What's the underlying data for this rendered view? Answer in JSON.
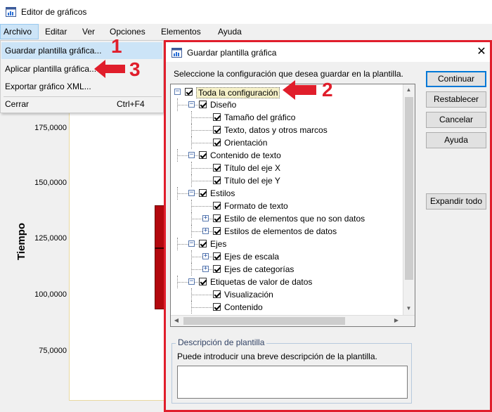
{
  "window": {
    "title": "Editor de gráficos"
  },
  "menubar": {
    "items": [
      "Archivo",
      "Editar",
      "Ver",
      "Opciones",
      "Elementos",
      "Ayuda"
    ]
  },
  "file_menu": {
    "items": [
      {
        "label": "Guardar plantilla gráfica...",
        "shortcut": ""
      },
      {
        "label": "Aplicar plantilla gráfica...",
        "shortcut": ""
      },
      {
        "label": "Exportar gráfico XML...",
        "shortcut": ""
      },
      {
        "label": "Cerrar",
        "shortcut": "Ctrl+F4"
      }
    ]
  },
  "chart": {
    "ytitle": "Tiempo",
    "yticks": [
      "175,0000",
      "150,0000",
      "125,0000",
      "100,0000",
      "75,0000"
    ]
  },
  "chart_data": {
    "type": "box",
    "ylabel": "Tiempo",
    "ytick_values": [
      175,
      150,
      125,
      100,
      75
    ],
    "box": {
      "q1": 94,
      "median": 121,
      "q3": 140
    }
  },
  "dialog": {
    "title": "Guardar plantilla gráfica",
    "close": "✕",
    "prompt": "Seleccione la configuración que desea guardar en la plantilla.",
    "tree": [
      {
        "label": "Toda la configuración",
        "level": 0,
        "expander": "−",
        "selected": true
      },
      {
        "label": "Diseño",
        "level": 1,
        "expander": "−"
      },
      {
        "label": "Tamaño del gráfico",
        "level": 2,
        "expander": ""
      },
      {
        "label": "Texto, datos y otros marcos",
        "level": 2,
        "expander": ""
      },
      {
        "label": "Orientación",
        "level": 2,
        "expander": ""
      },
      {
        "label": "Contenido de texto",
        "level": 1,
        "expander": "−"
      },
      {
        "label": "Título del eje X",
        "level": 2,
        "expander": ""
      },
      {
        "label": "Título del eje Y",
        "level": 2,
        "expander": ""
      },
      {
        "label": "Estilos",
        "level": 1,
        "expander": "−"
      },
      {
        "label": "Formato de texto",
        "level": 2,
        "expander": ""
      },
      {
        "label": "Estilo de elementos que no son datos",
        "level": 2,
        "expander": "+"
      },
      {
        "label": "Estilos de elementos de datos",
        "level": 2,
        "expander": "+"
      },
      {
        "label": "Ejes",
        "level": 1,
        "expander": "−"
      },
      {
        "label": "Ejes de escala",
        "level": 2,
        "expander": "+"
      },
      {
        "label": "Ejes de categorías",
        "level": 2,
        "expander": "+"
      },
      {
        "label": "Etiquetas de valor de datos",
        "level": 1,
        "expander": "−"
      },
      {
        "label": "Visualización",
        "level": 2,
        "expander": ""
      },
      {
        "label": "Contenido",
        "level": 2,
        "expander": ""
      }
    ],
    "buttons": {
      "continuar": "Continuar",
      "restablecer": "Restablecer",
      "cancelar": "Cancelar",
      "ayuda": "Ayuda",
      "expandir": "Expandir todo"
    },
    "description": {
      "legend": "Descripción de plantilla",
      "hint": "Puede introducir una breve descripción de la plantilla.",
      "value": ""
    }
  },
  "annotations": {
    "n1": "1",
    "n2": "2",
    "n3": "3",
    "color": "#e01e2b"
  }
}
